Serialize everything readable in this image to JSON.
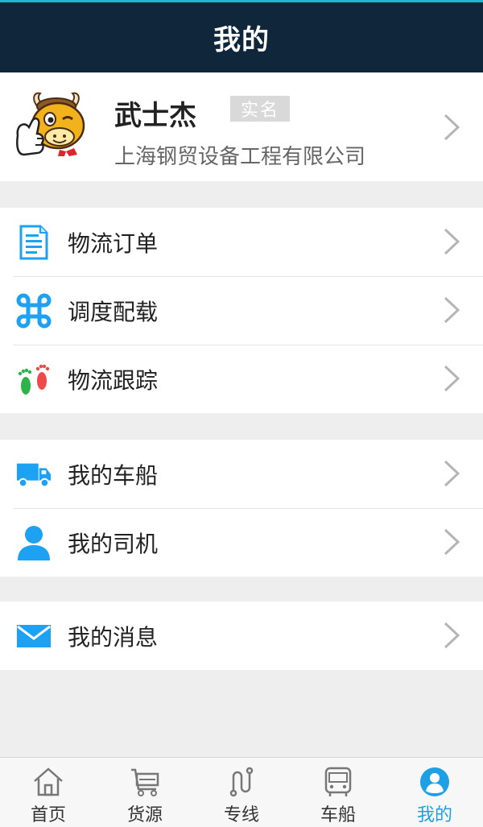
{
  "header": {
    "title": "我的"
  },
  "profile": {
    "name": "武士杰",
    "badge": "实名",
    "company": "上海钢贸设备工程有限公司"
  },
  "menu_groups": [
    {
      "items": [
        {
          "label": "物流订单",
          "icon": "document-icon"
        },
        {
          "label": "调度配载",
          "icon": "command-icon"
        },
        {
          "label": "物流跟踪",
          "icon": "footprints-icon"
        }
      ]
    },
    {
      "items": [
        {
          "label": "我的车船",
          "icon": "truck-icon"
        },
        {
          "label": "我的司机",
          "icon": "person-icon"
        }
      ]
    },
    {
      "items": [
        {
          "label": "我的消息",
          "icon": "envelope-icon"
        }
      ]
    }
  ],
  "tabbar": {
    "tabs": [
      {
        "label": "首页",
        "icon": "home-icon"
      },
      {
        "label": "货源",
        "icon": "cart-icon"
      },
      {
        "label": "专线",
        "icon": "route-icon"
      },
      {
        "label": "车船",
        "icon": "bus-icon"
      },
      {
        "label": "我的",
        "icon": "user-circle-icon",
        "active": true
      }
    ]
  },
  "colors": {
    "header_bg": "#10263a",
    "accent": "#1ea0e6",
    "icon_blue": "#1da1f2",
    "badge_bg": "#d9d9d9"
  }
}
